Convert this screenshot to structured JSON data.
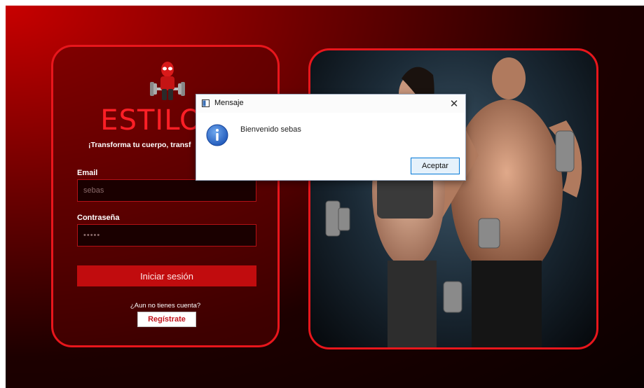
{
  "login": {
    "brand": "ESTILO 3",
    "slogan": "¡Transforma tu cuerpo, transf",
    "email_label": "Email",
    "email_value": "sebas",
    "password_label": "Contraseña",
    "password_value": "•••••",
    "login_button": "Iniciar sesión",
    "no_account_text": "¿Aun no tienes cuenta?",
    "register_button": "Regístrate"
  },
  "dialog": {
    "title": "Mensaje",
    "close_glyph": "✕",
    "message": "Bienvenido sebas",
    "accept_button": "Aceptar",
    "icon": "info-icon"
  },
  "colors": {
    "accent_red": "#e8161c",
    "button_red": "#c10c0e",
    "brand_red": "#ff1f26",
    "dialog_button_border": "#0078d7"
  },
  "images": {
    "mascot": "deadpool-weightlifting-mascot",
    "hero_photo": "fitness-couple-with-dumbbells"
  }
}
